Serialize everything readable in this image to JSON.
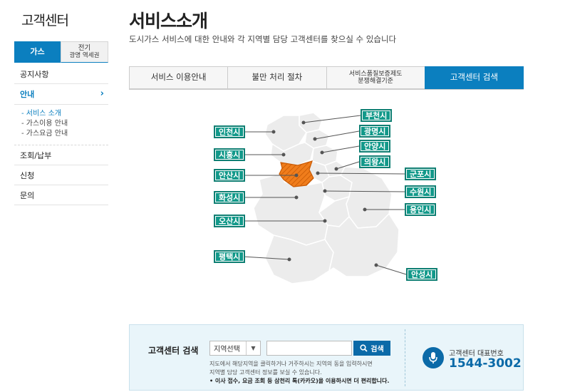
{
  "sidebar": {
    "title": "고객센터",
    "tabs": [
      {
        "label": "가스"
      },
      {
        "label": "전기",
        "sub": "광명 역세권"
      }
    ],
    "menu": [
      {
        "label": "공지사항"
      },
      {
        "label": "안내",
        "chevron": "›"
      },
      {
        "label": "조회/납부"
      },
      {
        "label": "신청"
      },
      {
        "label": "문의"
      }
    ],
    "submenu": [
      "- 서비스 소개",
      "- 가스이용 안내",
      "- 가스요금 안내"
    ]
  },
  "header": {
    "title": "서비스소개",
    "description": "도시가스 서비스에 대한 안내와 각 지역별 담당 고객센터를 찾으실 수 있습니다"
  },
  "tabs": [
    {
      "label": "서비스 이용안내"
    },
    {
      "label": "불만 처리 절차"
    },
    {
      "label": "서비스품질보증제도",
      "sub": "분쟁해결기준"
    },
    {
      "label": "고객센터 검색"
    }
  ],
  "map": {
    "regions": [
      "부천시",
      "인천시",
      "광명시",
      "시흥시",
      "안양시",
      "의왕시",
      "안산시",
      "군포시",
      "수원시",
      "화성시",
      "용인시",
      "오산시",
      "평택시",
      "안성시"
    ],
    "highlighted": "안산시",
    "colors": {
      "land": "#ececec",
      "border": "#ffffff",
      "highlight": "#f07d1c",
      "label": "#12998a"
    }
  },
  "search": {
    "title": "고객센터 검색",
    "select_value": "지역선택",
    "button_label": "검색",
    "help_line1": "지도에서 해당지역을 클릭하거나 거주하시는 지역의 동을 입력하시면",
    "help_line2": "지역별 담당 고객센터 정보를 보실 수 있습니다.",
    "help_note": "• 이사 접수, 요금 조회 등 삼천리 톡(카카오)을 이용하시면 더 편리합니다.",
    "rep_label": "고객센터 대표번호",
    "rep_number": "1544-3002"
  }
}
